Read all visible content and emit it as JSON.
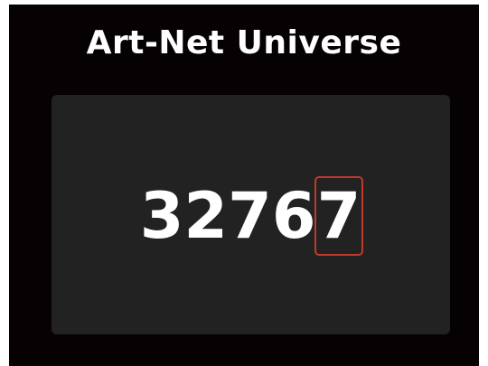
{
  "title": "Art-Net Universe",
  "value": {
    "digits": [
      "3",
      "2",
      "7",
      "6",
      "7"
    ],
    "active_index": 4
  },
  "colors": {
    "background": "#060203",
    "panel": "#222222",
    "text": "#ffffff",
    "cursor": "#c0392b"
  }
}
